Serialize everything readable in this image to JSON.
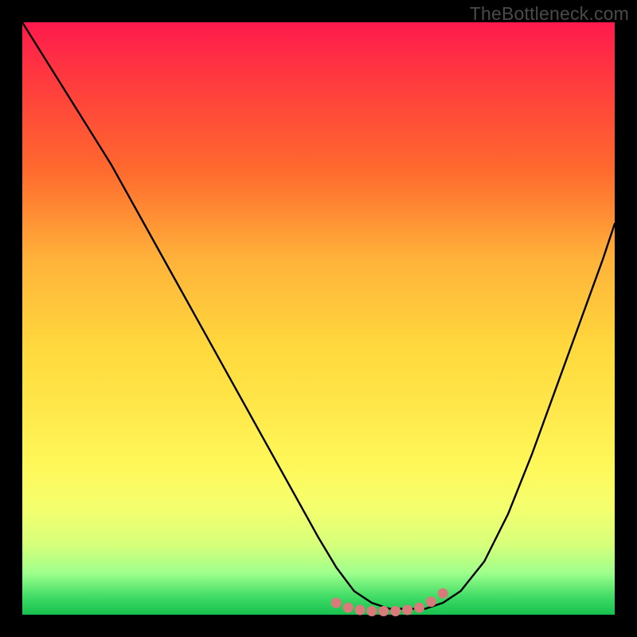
{
  "watermark": "TheBottleneck.com",
  "chart_data": {
    "type": "line",
    "title": "",
    "xlabel": "",
    "ylabel": "",
    "xlim": [
      0,
      100
    ],
    "ylim": [
      0,
      100
    ],
    "grid": false,
    "legend": false,
    "series": [
      {
        "name": "bottleneck-curve",
        "color": "#000000",
        "x": [
          0,
          5,
          10,
          15,
          20,
          25,
          30,
          35,
          40,
          45,
          50,
          53,
          56,
          59,
          62,
          65,
          68,
          71,
          74,
          78,
          82,
          86,
          90,
          94,
          98,
          100
        ],
        "values": [
          100,
          92,
          84,
          76,
          67,
          58,
          49,
          40,
          31,
          22,
          13,
          8,
          4,
          2,
          1,
          1,
          1,
          2,
          4,
          9,
          17,
          27,
          38,
          49,
          60,
          66
        ]
      }
    ],
    "markers": [
      {
        "name": "flat-region-dots",
        "color": "#d97b7b",
        "x": [
          53,
          55,
          57,
          59,
          61,
          63,
          65,
          67,
          69,
          71
        ],
        "values": [
          2.0,
          1.2,
          0.8,
          0.6,
          0.6,
          0.6,
          0.8,
          1.2,
          2.2,
          3.6
        ]
      }
    ]
  }
}
